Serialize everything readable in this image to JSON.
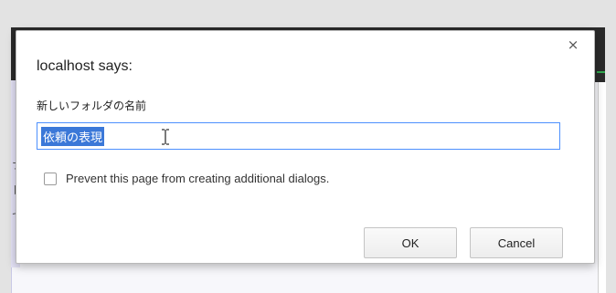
{
  "dialog": {
    "title": "localhost says:",
    "message": "新しいフォルダの名前",
    "input_value": "依頼の表現",
    "checkbox_label": "Prevent this page from creating additional dialogs.",
    "checkbox_checked": false,
    "ok_label": "OK",
    "cancel_label": "Cancel",
    "close_symbol": "×"
  },
  "background": {
    "glyphs": [
      "ナ",
      "レ",
      "セ"
    ]
  },
  "colors": {
    "focus_border": "#4d90fe",
    "selection": "#3b78d8"
  },
  "icons": {
    "cursor": "ibeam-cursor-icon",
    "close": "close-icon"
  }
}
